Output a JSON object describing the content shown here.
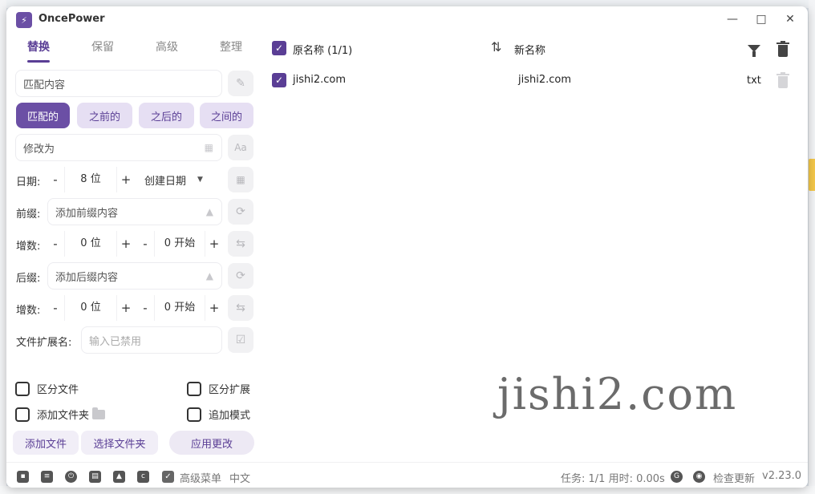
{
  "app": {
    "title": "OncePower",
    "logo_glyph": "⚡",
    "accent": "#6b4fa5"
  },
  "window_controls": {
    "minimize": "—",
    "maximize": "□",
    "close": "✕"
  },
  "tabs": [
    {
      "label": "替换"
    },
    {
      "label": "保留"
    },
    {
      "label": "高级"
    },
    {
      "label": "整理"
    }
  ],
  "match": {
    "placeholder": "匹配内容",
    "modes": [
      {
        "label": "匹配的"
      },
      {
        "label": "之前的"
      },
      {
        "label": "之后的"
      },
      {
        "label": "之间的"
      }
    ],
    "replace_placeholder": "修改为",
    "case_button": "Aa"
  },
  "date": {
    "label": "日期:",
    "minus": "-",
    "plus": "+",
    "digits": "8 位",
    "type": "创建日期"
  },
  "prefix": {
    "label": "前缀:",
    "placeholder": "添加前缀内容",
    "increment": {
      "label": "增数:",
      "digits": "0 位",
      "start": "0 开始",
      "minus": "-",
      "plus": "+"
    }
  },
  "suffix": {
    "label": "后缀:",
    "placeholder": "添加后缀内容",
    "increment": {
      "label": "增数:",
      "digits": "0 位",
      "start": "0 开始",
      "minus": "-",
      "plus": "+"
    }
  },
  "extension": {
    "label": "文件扩展名:",
    "placeholder": "输入已禁用"
  },
  "options": {
    "distinguish_file": "区分文件",
    "distinguish_ext": "区分扩展",
    "add_folder": "添加文件夹",
    "append_mode": "追加模式"
  },
  "actions": {
    "add_file": "添加文件",
    "select_folder": "选择文件夹",
    "apply": "应用更改"
  },
  "list": {
    "header_original": "原名称 (1/1)",
    "header_new": "新名称",
    "sort_glyph": "⇅",
    "rows": [
      {
        "original": "jishi2.com",
        "new_name": "jishi2.com",
        "ext": "txt"
      }
    ]
  },
  "watermark": "jishi2.com",
  "statusbar": {
    "advanced_menu": "高级菜单",
    "language": "中文",
    "task": "任务: 1/1 用时: 0.00s",
    "check_update": "检查更新",
    "version": "v2.23.0"
  }
}
